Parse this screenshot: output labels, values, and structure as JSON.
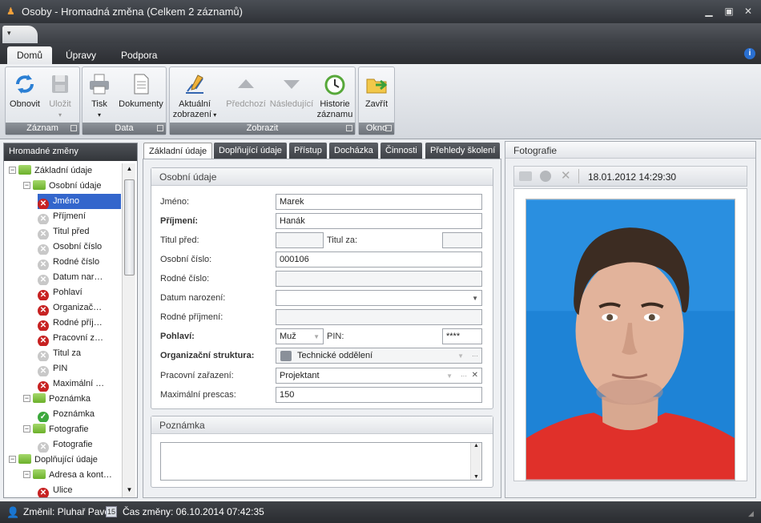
{
  "window": {
    "title": "Osoby - Hromadná změna (Celkem 2 záznamů)"
  },
  "ribbon": {
    "tabs": [
      "Domů",
      "Úpravy",
      "Podpora"
    ],
    "groups": {
      "zaznam": {
        "label": "Záznam",
        "refresh": "Obnovit",
        "save": "Uložit"
      },
      "data": {
        "label": "Data",
        "print": "Tisk",
        "documents": "Dokumenty"
      },
      "zobrazit": {
        "label": "Zobrazit",
        "current_l1": "Aktuální",
        "current_l2": "zobrazení",
        "prev": "Předchozí",
        "next": "Následující",
        "history_l1": "Historie",
        "history_l2": "záznamu"
      },
      "okno": {
        "label": "Okno",
        "close": "Zavřít"
      }
    }
  },
  "left_panel": {
    "title": "Hromadné změny",
    "tree": [
      {
        "label": "Základní údaje",
        "kind": "folder"
      },
      {
        "label": "Osobní údaje",
        "kind": "folder"
      },
      {
        "label": "Jméno",
        "kind": "red",
        "selected": true
      },
      {
        "label": "Příjmení",
        "kind": "gray"
      },
      {
        "label": "Titul před",
        "kind": "gray"
      },
      {
        "label": "Osobní číslo",
        "kind": "gray"
      },
      {
        "label": "Rodné číslo",
        "kind": "gray"
      },
      {
        "label": "Datum nar…",
        "kind": "gray"
      },
      {
        "label": "Pohlaví",
        "kind": "red"
      },
      {
        "label": "Organizač…",
        "kind": "red"
      },
      {
        "label": "Rodné příj…",
        "kind": "red"
      },
      {
        "label": "Pracovní z…",
        "kind": "red"
      },
      {
        "label": "Titul za",
        "kind": "gray"
      },
      {
        "label": "PIN",
        "kind": "gray"
      },
      {
        "label": "Maximální …",
        "kind": "red"
      },
      {
        "label": "Poznámka",
        "kind": "folder"
      },
      {
        "label": "Poznámka",
        "kind": "green"
      },
      {
        "label": "Fotografie",
        "kind": "folder"
      },
      {
        "label": "Fotografie",
        "kind": "gray"
      },
      {
        "label": "Doplňující údaje",
        "kind": "folder"
      },
      {
        "label": "Adresa a kont…",
        "kind": "folder"
      },
      {
        "label": "Ulice",
        "kind": "red"
      }
    ]
  },
  "center_tabs": [
    "Základní údaje",
    "Doplňující údaje",
    "Přístup",
    "Docházka",
    "Činnosti",
    "Přehledy školení"
  ],
  "osobni_udaje": {
    "title": "Osobní údaje",
    "jmeno_label": "Jméno:",
    "jmeno": "Marek",
    "prijmeni_label": "Příjmení:",
    "prijmeni": "Hanák",
    "titul_pred_label": "Titul před:",
    "titul_pred": "",
    "titul_za_label": "Titul za:",
    "titul_za": "",
    "osobni_cislo_label": "Osobní číslo:",
    "osobni_cislo": "000106",
    "rodne_cislo_label": "Rodné číslo:",
    "rodne_cislo": "",
    "datum_narozeni_label": "Datum narození:",
    "datum_narozeni": "",
    "rodne_prijmeni_label": "Rodné příjmení:",
    "rodne_prijmeni": "",
    "pohlavi_label": "Pohlaví:",
    "pohlavi": "Muž",
    "pin_label": "PIN:",
    "pin": "****",
    "org_label": "Organizační struktura:",
    "org": "Technické oddělení",
    "prac_label": "Pracovní zařazení:",
    "prac": "Projektant",
    "max_label": "Maximální prescas:",
    "max": "150"
  },
  "poznamka": {
    "title": "Poznámka",
    "text": ""
  },
  "photo_panel": {
    "title": "Fotografie",
    "timestamp": "18.01.2012 14:29:30"
  },
  "status": {
    "changed_by": "Změnil: Pluhař Pavel",
    "change_time": "Čas změny: 06.10.2014 07:42:35"
  }
}
